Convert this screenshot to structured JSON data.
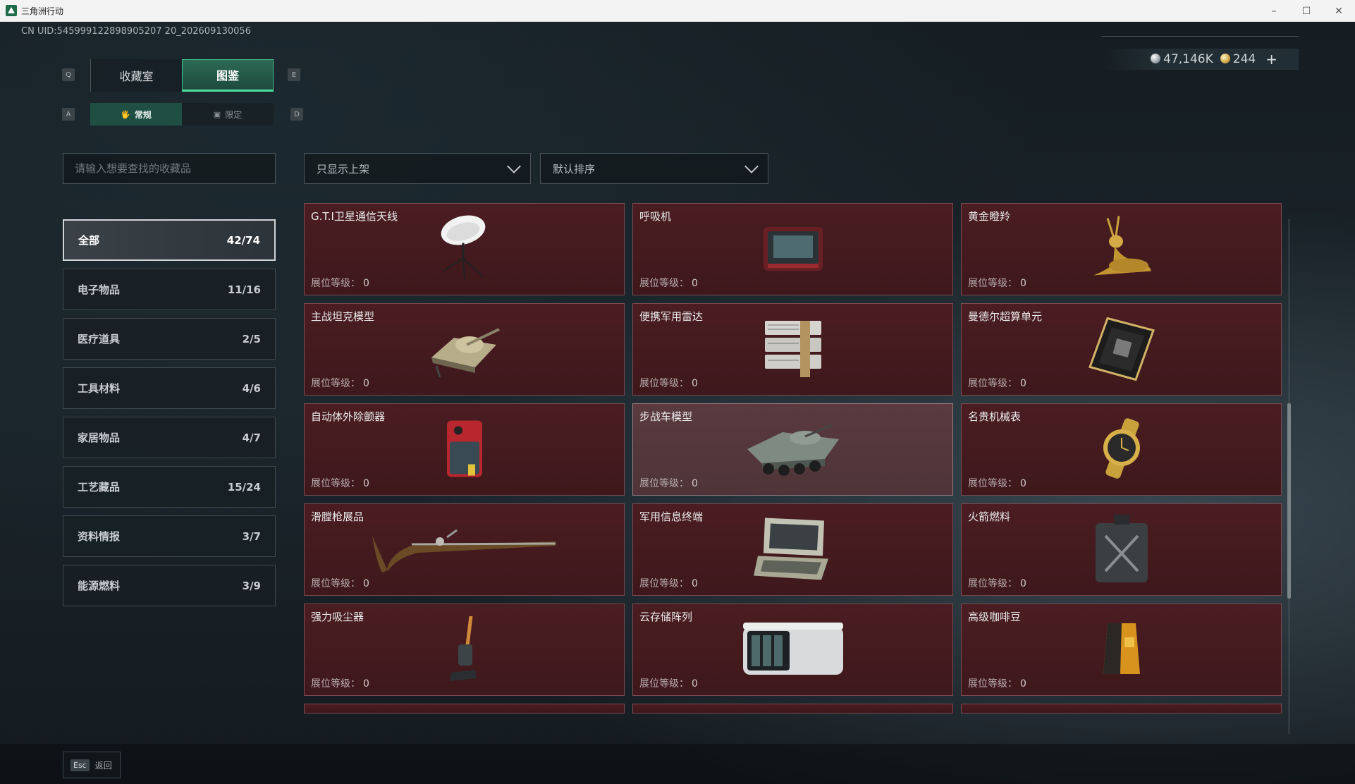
{
  "window": {
    "title": "三角洲行动",
    "min": "–",
    "max": "☐",
    "close": "✕"
  },
  "uid": "CN UID:545999122898905207 20_202609130056",
  "currency": {
    "silver": "47,146K",
    "gold": "244",
    "plus": "+"
  },
  "keys": {
    "q": "Q",
    "e": "E",
    "a": "A",
    "d": "D"
  },
  "main_tabs": [
    {
      "label": "收藏室"
    },
    {
      "label": "图鉴"
    }
  ],
  "sub_tabs": [
    {
      "label": "常规",
      "icon": "🖐"
    },
    {
      "label": "限定",
      "icon": "▣"
    }
  ],
  "search": {
    "placeholder": "请输入想要查找的收藏品",
    "value": ""
  },
  "filters": {
    "shelf": "只显示上架",
    "sort": "默认排序"
  },
  "categories": [
    {
      "label": "全部",
      "count": "42/74"
    },
    {
      "label": "电子物品",
      "count": "11/16"
    },
    {
      "label": "医疗道具",
      "count": "2/5"
    },
    {
      "label": "工具材料",
      "count": "4/6"
    },
    {
      "label": "家居物品",
      "count": "4/7"
    },
    {
      "label": "工艺藏品",
      "count": "15/24"
    },
    {
      "label": "资料情报",
      "count": "3/7"
    },
    {
      "label": "能源燃料",
      "count": "3/9"
    }
  ],
  "level_label": "展位等级：",
  "items": [
    {
      "name": "G.T.I卫星通信天线",
      "level": "0",
      "icon": "satellite-dish-icon"
    },
    {
      "name": "呼吸机",
      "level": "0",
      "icon": "ventilator-icon"
    },
    {
      "name": "黄金瞪羚",
      "level": "0",
      "icon": "golden-gazelle-icon"
    },
    {
      "name": "主战坦克模型",
      "level": "0",
      "icon": "tank-model-icon"
    },
    {
      "name": "便携军用雷达",
      "level": "0",
      "icon": "radar-icon"
    },
    {
      "name": "曼德尔超算单元",
      "level": "0",
      "icon": "computing-unit-icon"
    },
    {
      "name": "自动体外除颤器",
      "level": "0",
      "icon": "defibrillator-icon"
    },
    {
      "name": "步战车模型",
      "level": "0",
      "icon": "ifv-model-icon"
    },
    {
      "name": "名贵机械表",
      "level": "0",
      "icon": "watch-icon"
    },
    {
      "name": "滑膛枪展品",
      "level": "0",
      "icon": "musket-icon"
    },
    {
      "name": "军用信息终端",
      "level": "0",
      "icon": "terminal-icon"
    },
    {
      "name": "火箭燃料",
      "level": "0",
      "icon": "fuel-can-icon"
    },
    {
      "name": "强力吸尘器",
      "level": "0",
      "icon": "vacuum-icon"
    },
    {
      "name": "云存储阵列",
      "level": "0",
      "icon": "storage-array-icon"
    },
    {
      "name": "高级咖啡豆",
      "level": "0",
      "icon": "coffee-bag-icon"
    }
  ],
  "back": {
    "key": "Esc",
    "label": "返回"
  }
}
